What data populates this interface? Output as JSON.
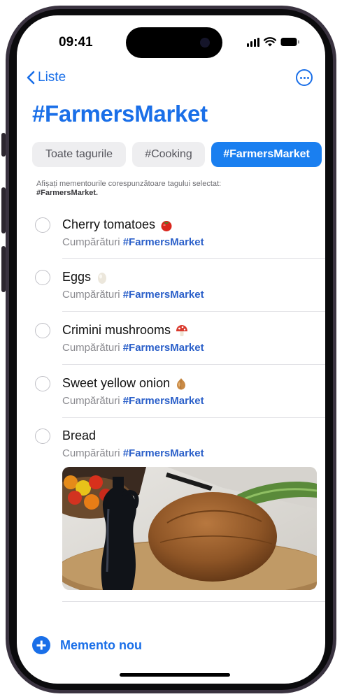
{
  "status": {
    "time": "09:41"
  },
  "nav": {
    "back_label": "Liste"
  },
  "title": "#FarmersMarket",
  "tags": [
    {
      "label": "Toate tagurile",
      "selected": false
    },
    {
      "label": "#Cooking",
      "selected": false
    },
    {
      "label": "#FarmersMarket",
      "selected": true
    }
  ],
  "hint": {
    "text": "Afișați mementourile corespunzătoare tagului selectat:",
    "tag": "#FarmersMarket."
  },
  "reminders": [
    {
      "title": "Cherry tomatoes",
      "emoji": "tomato-icon",
      "list": "Cumpărături",
      "tag": "#FarmersMarket"
    },
    {
      "title": "Eggs",
      "emoji": "egg-icon",
      "list": "Cumpărături",
      "tag": "#FarmersMarket"
    },
    {
      "title": "Crimini mushrooms",
      "emoji": "mushroom-icon",
      "list": "Cumpărături",
      "tag": "#FarmersMarket"
    },
    {
      "title": "Sweet yellow onion",
      "emoji": "onion-icon",
      "list": "Cumpărături",
      "tag": "#FarmersMarket"
    },
    {
      "title": "Bread",
      "emoji": "",
      "list": "Cumpărături",
      "tag": "#FarmersMarket"
    }
  ],
  "footer": {
    "new_reminder_label": "Memento nou"
  },
  "colors": {
    "accent": "#1a6fe8",
    "selected_tag": "#1a7ff0",
    "tag_text": "#2a5fc9"
  }
}
